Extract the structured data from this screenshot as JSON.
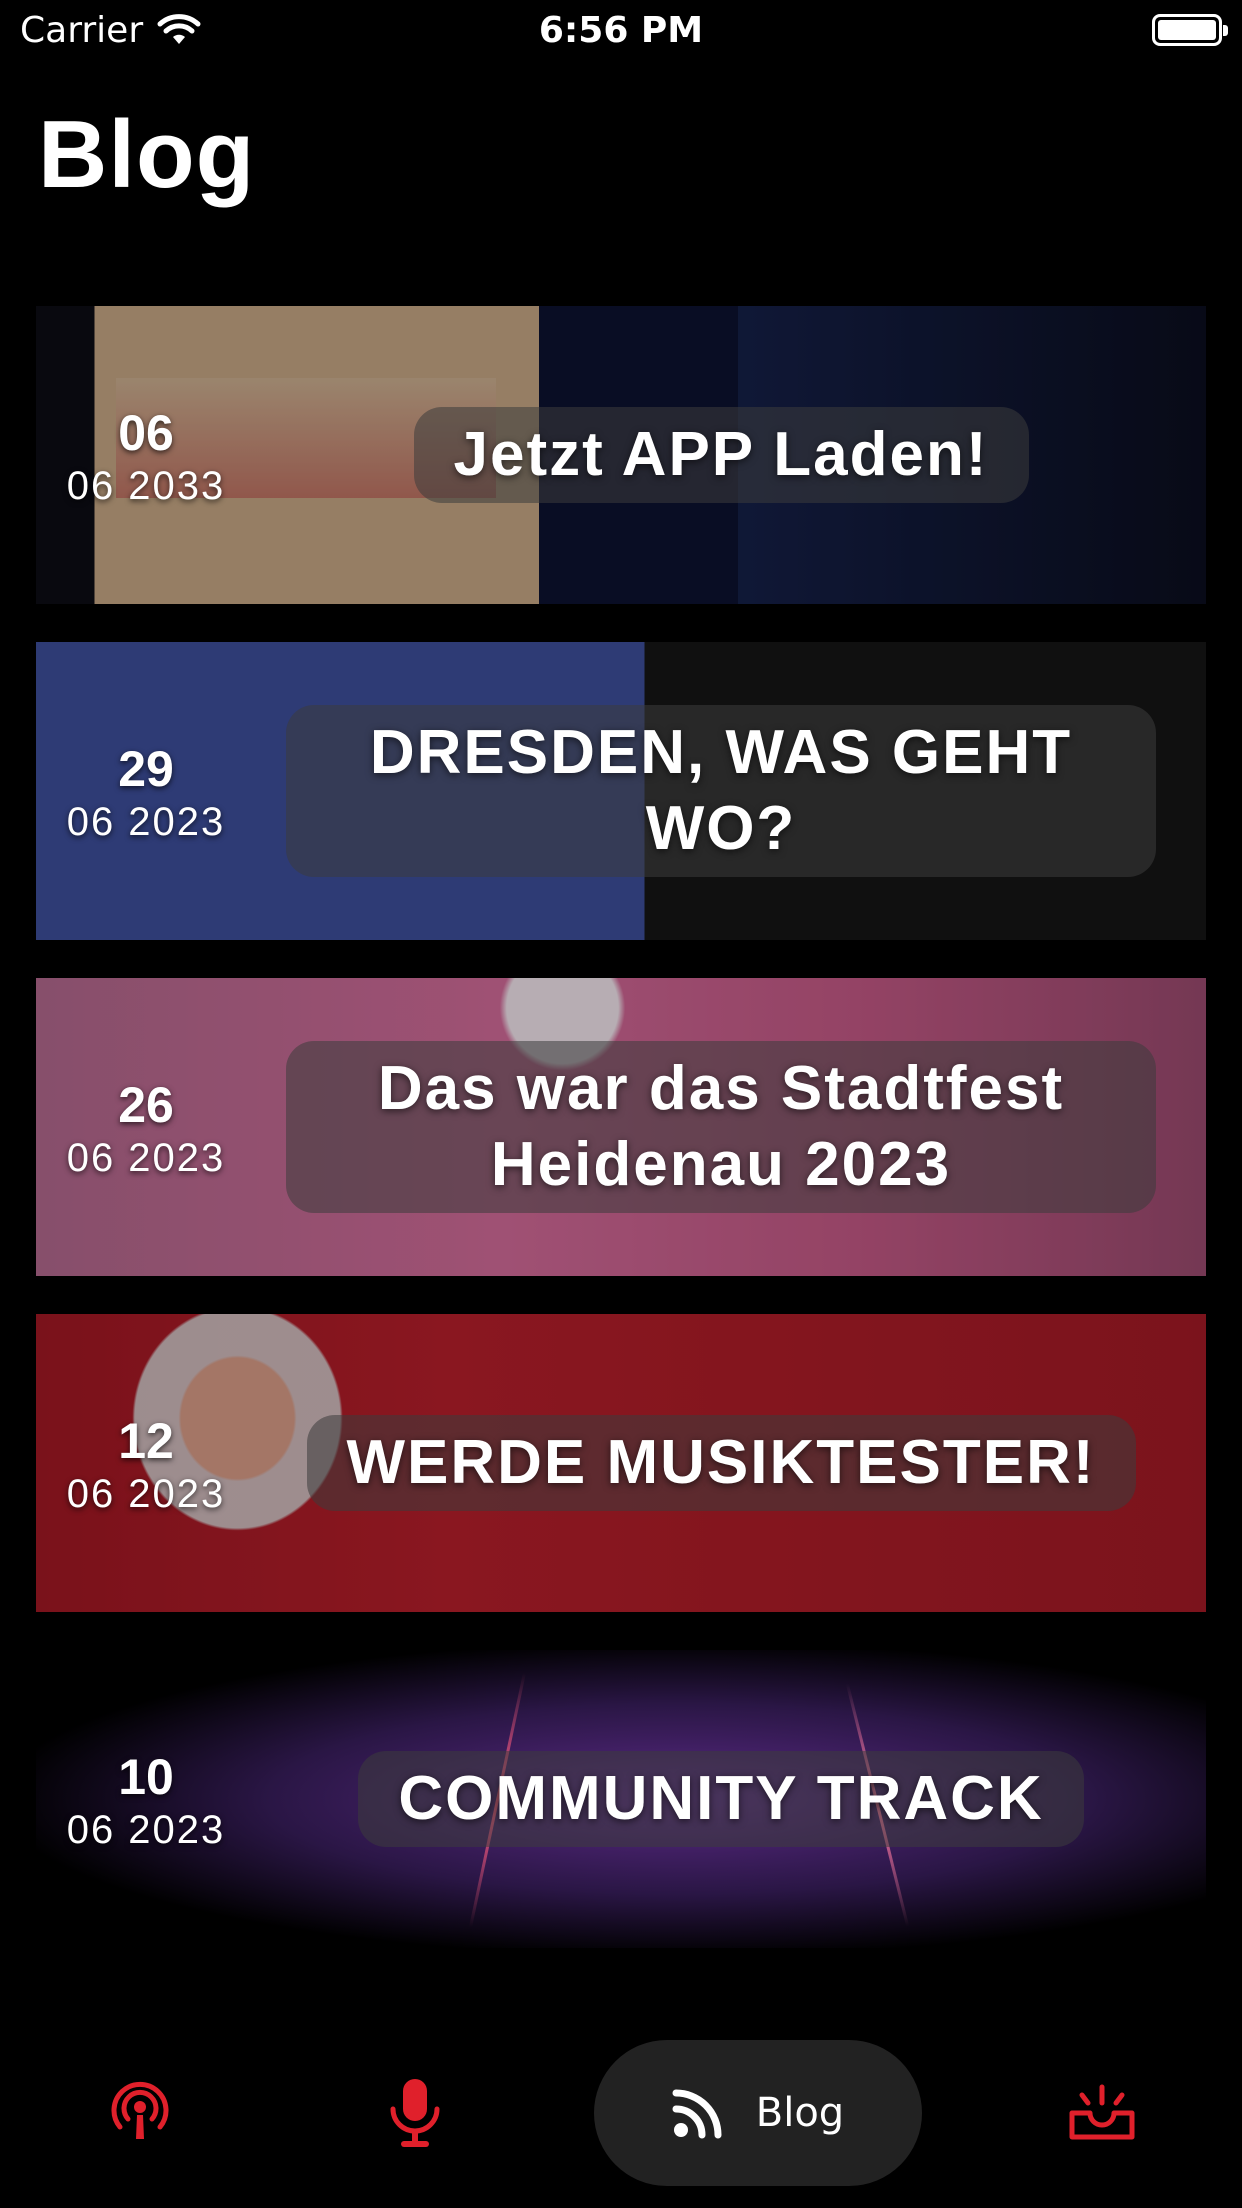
{
  "status_bar": {
    "carrier": "Carrier",
    "time": "6:56 PM"
  },
  "page_title": "Blog",
  "posts": [
    {
      "day": "06",
      "month_year": "06 2033",
      "title": "Jetzt APP Laden!"
    },
    {
      "day": "29",
      "month_year": "06 2023",
      "title": "DRESDEN, WAS GEHT WO?"
    },
    {
      "day": "26",
      "month_year": "06 2023",
      "title": "Das war das Stadtfest Heidenau 2023"
    },
    {
      "day": "12",
      "month_year": "06 2023",
      "title": "WERDE MUSIKTESTER!"
    },
    {
      "day": "10",
      "month_year": "06 2023",
      "title": "COMMUNITY TRACK"
    }
  ],
  "tab_bar": {
    "blog_label": "Blog",
    "icons": [
      "podcast-icon",
      "microphone-icon",
      "rss-icon",
      "inbox-icon"
    ],
    "accent_color": "#e0202b",
    "active_pill_color": "#222222"
  }
}
